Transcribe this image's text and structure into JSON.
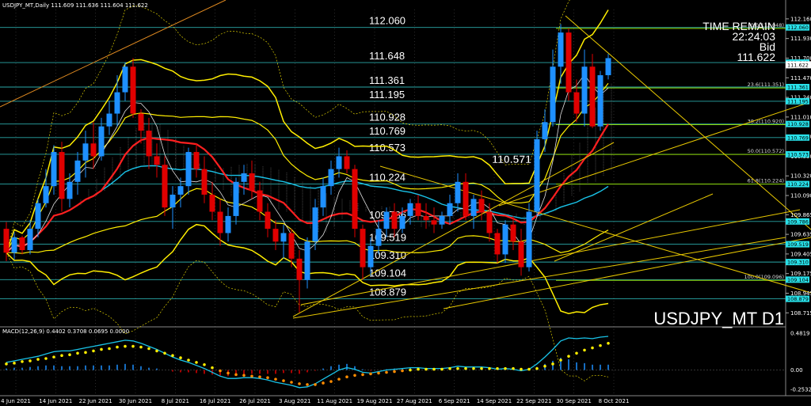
{
  "header": {
    "symbol_line": "USDJPY_MT,Daily  111.609 111.636 111.604 111.622",
    "macd_line": "MACD(12,26,9) 0.4402 0.3708 0.0695 0.0000"
  },
  "info": {
    "time_label": "TIME REMAIN",
    "time_value": "22:24:03",
    "bid_label": "Bid",
    "bid_value": "111.622",
    "chart_label": "USDJPY_MT D1"
  },
  "colors": {
    "background": "#000000",
    "bull": "#1e90ff",
    "bear": "#e00000",
    "level_line": "#2aa8a8",
    "fib_line": "#8fd400",
    "bollinger": "#ffee00",
    "trend": "#e8c800",
    "ma_red": "#ff2020",
    "ma_cyan": "#19c3e8",
    "ma_white": "#e0e0e0",
    "macd_line": "#19c3e8",
    "macd_signal": "#ffee00",
    "price_tag": "#28e0e8",
    "grid": "#555555"
  },
  "chart_data": {
    "type": "candlestick",
    "title": "USDJPY_MT D1",
    "ylim": [
      108.56,
      112.27
    ],
    "y_ticks": [
      "112.160",
      "111.930",
      "111.700",
      "111.470",
      "111.240",
      "111.010",
      "110.780",
      "110.550",
      "110.320",
      "110.090",
      "109.865",
      "109.635",
      "109.405",
      "109.175",
      "108.945",
      "108.715"
    ],
    "x_tick_labels": [
      "4 Jun 2021",
      "14 Jun 2021",
      "22 Jun 2021",
      "30 Jun 2021",
      "8 Jul 2021",
      "16 Jul 2021",
      "26 Jul 2021",
      "3 Aug 2021",
      "11 Aug 2021",
      "19 Aug 2021",
      "27 Aug 2021",
      "6 Sep 2021",
      "14 Sep 2021",
      "22 Sep 2021",
      "30 Sep 2021",
      "8 Oct 2021"
    ],
    "price_levels": [
      "112.060",
      "111.648",
      "111.361",
      "111.195",
      "110.928",
      "110.769",
      "110.573",
      "110.224",
      "109.786",
      "109.519",
      "109.310",
      "109.104",
      "108.879"
    ],
    "price_level_tags": [
      "112.060",
      "111.648",
      "111.361",
      "111.195",
      "110.928",
      "110.769",
      "110.573",
      "110.224",
      "109.786",
      "109.519",
      "109.310",
      "109.104",
      "108.879"
    ],
    "fib_levels": [
      {
        "label": "0.0(112.048)",
        "value": 112.048
      },
      {
        "label": "23.6(111.351)",
        "value": 111.351
      },
      {
        "label": "38.2(110.920)",
        "value": 110.92
      },
      {
        "label": "50.0(110.572)",
        "value": 110.572
      },
      {
        "label": "61.8(110.224)",
        "value": 110.224
      },
      {
        "label": "100.0(109.096)",
        "value": 109.096
      }
    ],
    "annotation": "110.571",
    "current_price": "111.622",
    "candles": [
      [
        109.7,
        109.78,
        109.32,
        109.42
      ],
      [
        109.42,
        109.66,
        109.34,
        109.6
      ],
      [
        109.6,
        109.62,
        109.4,
        109.45
      ],
      [
        109.45,
        109.8,
        109.4,
        109.7
      ],
      [
        109.7,
        110.05,
        109.6,
        110.0
      ],
      [
        110.0,
        110.4,
        109.95,
        110.2
      ],
      [
        110.2,
        110.68,
        110.1,
        110.6
      ],
      [
        110.6,
        110.72,
        109.9,
        110.05
      ],
      [
        110.05,
        110.35,
        109.95,
        110.25
      ],
      [
        110.25,
        110.6,
        110.1,
        110.5
      ],
      [
        110.5,
        110.85,
        110.3,
        110.7
      ],
      [
        110.7,
        110.95,
        110.4,
        110.55
      ],
      [
        110.55,
        111.0,
        110.5,
        110.9
      ],
      [
        110.9,
        111.2,
        110.8,
        111.05
      ],
      [
        111.05,
        111.5,
        110.9,
        111.3
      ],
      [
        111.3,
        111.65,
        111.2,
        111.6
      ],
      [
        111.6,
        111.7,
        111.0,
        111.05
      ],
      [
        111.05,
        111.1,
        110.7,
        110.85
      ],
      [
        110.85,
        111.0,
        110.4,
        110.55
      ],
      [
        110.55,
        110.7,
        110.3,
        110.45
      ],
      [
        110.45,
        110.55,
        109.85,
        109.95
      ],
      [
        109.95,
        110.2,
        109.7,
        110.1
      ],
      [
        110.1,
        110.3,
        109.95,
        110.2
      ],
      [
        110.2,
        110.65,
        110.1,
        110.6
      ],
      [
        110.6,
        110.7,
        110.3,
        110.4
      ],
      [
        110.4,
        110.55,
        110.0,
        110.1
      ],
      [
        110.1,
        110.25,
        109.8,
        109.9
      ],
      [
        109.9,
        110.05,
        109.5,
        109.65
      ],
      [
        109.65,
        109.95,
        109.55,
        109.85
      ],
      [
        109.85,
        110.3,
        109.75,
        110.25
      ],
      [
        110.25,
        110.45,
        110.1,
        110.35
      ],
      [
        110.35,
        110.5,
        110.05,
        110.15
      ],
      [
        110.15,
        110.25,
        109.8,
        109.9
      ],
      [
        109.9,
        110.0,
        109.6,
        109.7
      ],
      [
        109.7,
        109.8,
        109.45,
        109.55
      ],
      [
        109.55,
        109.75,
        109.35,
        109.65
      ],
      [
        109.65,
        109.7,
        109.25,
        109.35
      ],
      [
        109.35,
        109.45,
        108.72,
        109.1
      ],
      [
        109.1,
        109.6,
        109.0,
        109.55
      ],
      [
        109.55,
        110.05,
        109.45,
        109.95
      ],
      [
        109.95,
        110.3,
        109.85,
        110.2
      ],
      [
        110.2,
        110.5,
        110.1,
        110.4
      ],
      [
        110.4,
        110.65,
        110.3,
        110.55
      ],
      [
        110.55,
        110.62,
        110.35,
        110.4
      ],
      [
        110.4,
        110.45,
        109.6,
        109.7
      ],
      [
        109.7,
        109.75,
        109.1,
        109.25
      ],
      [
        109.25,
        109.6,
        109.15,
        109.5
      ],
      [
        109.5,
        109.8,
        109.4,
        109.7
      ],
      [
        109.7,
        109.95,
        109.6,
        109.9
      ],
      [
        109.9,
        110.0,
        109.6,
        109.7
      ],
      [
        109.7,
        109.95,
        109.65,
        109.85
      ],
      [
        109.85,
        110.05,
        109.75,
        110.0
      ],
      [
        110.0,
        110.1,
        109.8,
        109.85
      ],
      [
        109.85,
        110.0,
        109.7,
        109.8
      ],
      [
        109.8,
        109.95,
        109.65,
        109.75
      ],
      [
        109.75,
        109.9,
        109.7,
        109.85
      ],
      [
        109.85,
        110.1,
        109.75,
        110.0
      ],
      [
        110.0,
        110.35,
        109.9,
        110.25
      ],
      [
        110.25,
        110.35,
        109.8,
        109.85
      ],
      [
        109.85,
        110.1,
        109.7,
        110.05
      ],
      [
        110.05,
        110.15,
        109.8,
        109.9
      ],
      [
        109.9,
        110.0,
        109.55,
        109.65
      ],
      [
        109.65,
        109.7,
        109.3,
        109.4
      ],
      [
        109.4,
        109.8,
        109.3,
        109.75
      ],
      [
        109.75,
        109.85,
        109.45,
        109.55
      ],
      [
        109.55,
        109.7,
        109.15,
        109.25
      ],
      [
        109.25,
        110.0,
        109.2,
        109.9
      ],
      [
        109.9,
        110.85,
        109.85,
        110.75
      ],
      [
        110.75,
        111.1,
        110.6,
        110.95
      ],
      [
        110.95,
        111.8,
        110.9,
        111.6
      ],
      [
        111.6,
        112.1,
        111.4,
        112.0
      ],
      [
        112.0,
        112.05,
        111.2,
        111.3
      ],
      [
        111.3,
        111.45,
        110.95,
        111.05
      ],
      [
        111.05,
        111.8,
        110.9,
        111.6
      ],
      [
        111.6,
        111.75,
        110.88,
        110.9
      ],
      [
        110.9,
        111.55,
        110.85,
        111.5
      ],
      [
        111.5,
        111.75,
        111.45,
        111.7
      ]
    ],
    "macd_ylim": [
      -0.2532,
      0.4819
    ],
    "macd_ticks": [
      "0.4819",
      "0.00",
      "-0.2532"
    ],
    "macd_hist": [
      0.02,
      0.03,
      0.03,
      0.04,
      0.05,
      0.06,
      0.06,
      0.05,
      0.05,
      0.05,
      0.06,
      0.06,
      0.06,
      0.06,
      0.07,
      0.08,
      0.07,
      0.05,
      0.03,
      0.02,
      0.0,
      -0.02,
      -0.03,
      -0.03,
      -0.04,
      -0.05,
      -0.06,
      -0.07,
      -0.08,
      -0.07,
      -0.06,
      -0.05,
      -0.05,
      -0.05,
      -0.05,
      -0.04,
      -0.04,
      -0.05,
      -0.03,
      -0.01,
      0.02,
      0.05,
      0.07,
      0.08,
      0.05,
      0.01,
      -0.01,
      0.0,
      0.01,
      0.02,
      0.02,
      0.03,
      0.03,
      0.02,
      0.02,
      0.02,
      0.02,
      0.03,
      0.02,
      0.02,
      0.02,
      0.01,
      0.0,
      0.01,
      0.0,
      -0.01,
      0.0,
      0.04,
      0.08,
      0.12,
      0.16,
      0.14,
      0.1,
      0.09,
      0.07,
      0.07,
      0.07
    ],
    "macd_main": [
      0.1,
      0.12,
      0.14,
      0.16,
      0.18,
      0.21,
      0.24,
      0.25,
      0.25,
      0.27,
      0.29,
      0.31,
      0.33,
      0.35,
      0.37,
      0.39,
      0.38,
      0.35,
      0.31,
      0.27,
      0.22,
      0.17,
      0.13,
      0.1,
      0.06,
      0.02,
      -0.03,
      -0.08,
      -0.11,
      -0.11,
      -0.1,
      -0.1,
      -0.11,
      -0.13,
      -0.16,
      -0.18,
      -0.2,
      -0.23,
      -0.22,
      -0.18,
      -0.12,
      -0.06,
      0.0,
      0.03,
      0.01,
      -0.03,
      -0.04,
      -0.02,
      0.0,
      0.01,
      0.02,
      0.03,
      0.03,
      0.02,
      0.02,
      0.02,
      0.03,
      0.05,
      0.04,
      0.04,
      0.04,
      0.03,
      0.01,
      0.02,
      0.01,
      -0.01,
      0.01,
      0.08,
      0.17,
      0.27,
      0.38,
      0.42,
      0.41,
      0.42,
      0.41,
      0.43,
      0.44
    ],
    "macd_signal": [
      0.08,
      0.09,
      0.11,
      0.12,
      0.14,
      0.15,
      0.17,
      0.19,
      0.2,
      0.22,
      0.23,
      0.25,
      0.27,
      0.28,
      0.3,
      0.31,
      0.31,
      0.3,
      0.28,
      0.25,
      0.22,
      0.19,
      0.16,
      0.13,
      0.1,
      0.07,
      0.03,
      -0.01,
      -0.04,
      -0.06,
      -0.07,
      -0.08,
      -0.09,
      -0.1,
      -0.12,
      -0.14,
      -0.16,
      -0.18,
      -0.19,
      -0.19,
      -0.17,
      -0.15,
      -0.12,
      -0.09,
      -0.07,
      -0.06,
      -0.05,
      -0.04,
      -0.03,
      -0.02,
      -0.01,
      0.0,
      0.01,
      0.01,
      0.01,
      0.01,
      0.02,
      0.02,
      0.02,
      0.02,
      0.02,
      0.02,
      0.02,
      0.02,
      0.02,
      0.01,
      0.01,
      0.02,
      0.05,
      0.08,
      0.13,
      0.18,
      0.22,
      0.26,
      0.29,
      0.32,
      0.35
    ]
  }
}
